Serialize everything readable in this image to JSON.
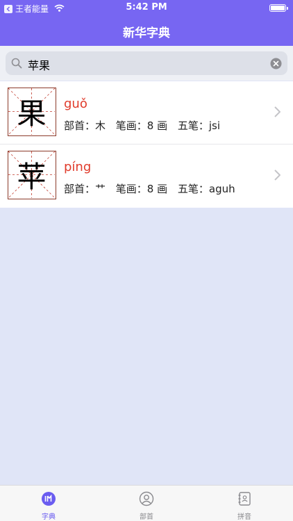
{
  "status": {
    "carrier": "王者能量",
    "time": "5:42 PM"
  },
  "header": {
    "title": "新华字典"
  },
  "search": {
    "query": "苹果"
  },
  "results": [
    {
      "char": "果",
      "pinyin": "guǒ",
      "radical": "部首：木",
      "strokes": "笔画：8 画",
      "wubi": "五笔：jsi"
    },
    {
      "char": "苹",
      "pinyin": "píng",
      "radical": "部首：艹",
      "strokes": "笔画：8 画",
      "wubi": "五笔：aguh"
    }
  ],
  "tabs": [
    {
      "label": "字典",
      "icon": "dictionary-icon",
      "active": true
    },
    {
      "label": "部首",
      "icon": "person-icon",
      "active": false
    },
    {
      "label": "拼音",
      "icon": "contacts-book-icon",
      "active": false
    }
  ],
  "colors": {
    "accent": "#7766f2",
    "pinyin": "#e03b2b",
    "box_border": "#8b3a2a",
    "background": "#e0e5f7"
  }
}
